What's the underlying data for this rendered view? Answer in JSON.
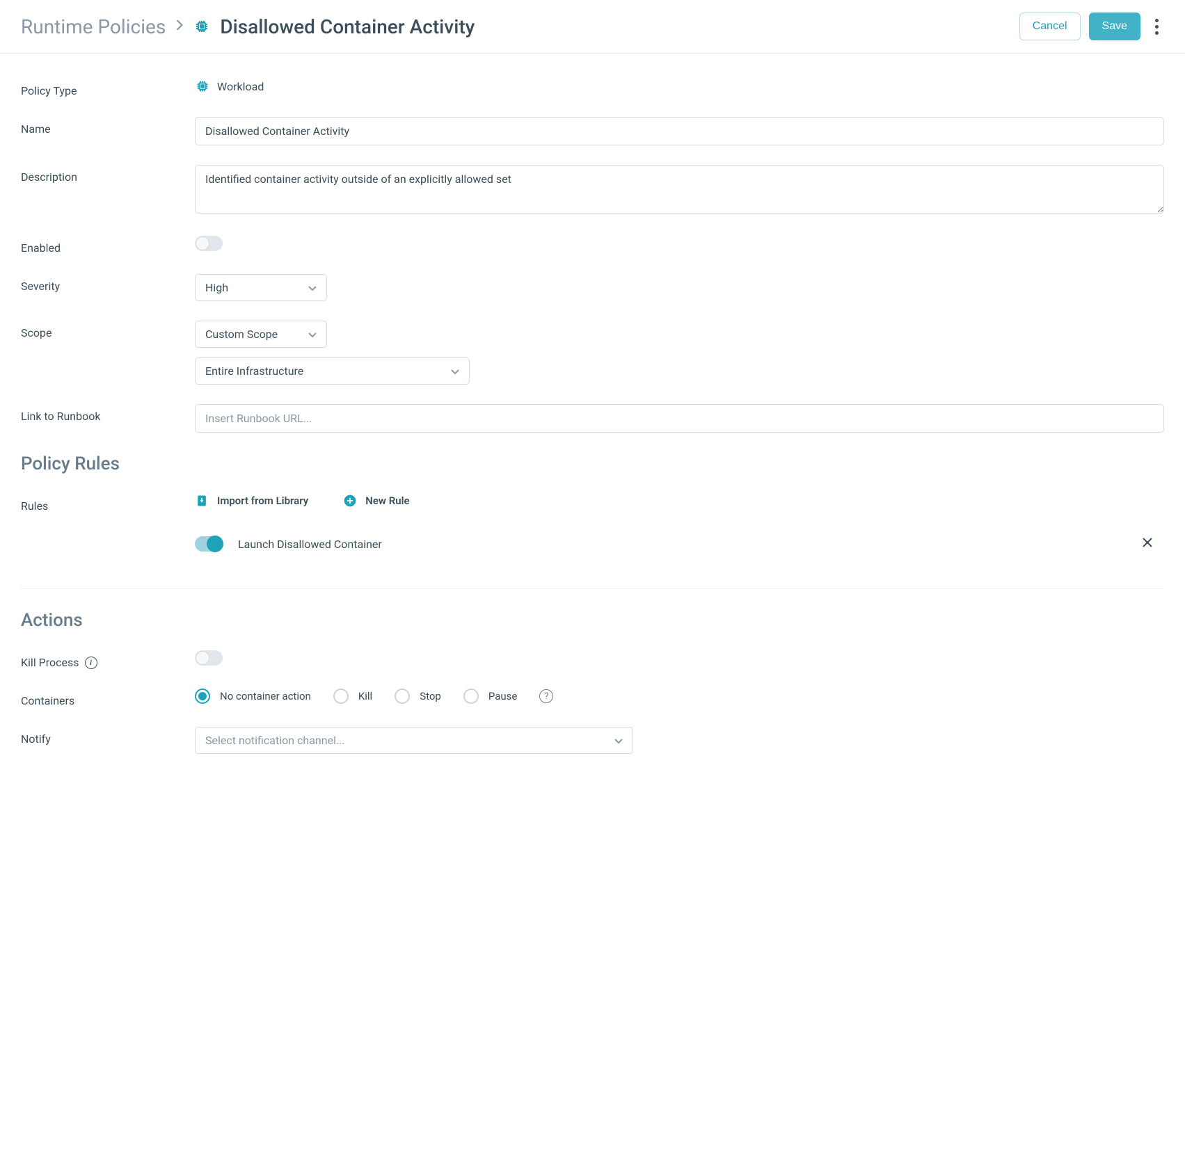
{
  "header": {
    "breadcrumb_root": "Runtime Policies",
    "title": "Disallowed Container Activity",
    "cancel_label": "Cancel",
    "save_label": "Save"
  },
  "form": {
    "policy_type_label": "Policy Type",
    "policy_type_value": "Workload",
    "name_label": "Name",
    "name_value": "Disallowed Container Activity",
    "description_label": "Description",
    "description_value": "Identified container activity outside of an explicitly allowed set",
    "enabled_label": "Enabled",
    "enabled_value": false,
    "severity_label": "Severity",
    "severity_value": "High",
    "scope_label": "Scope",
    "scope_value": "Custom Scope",
    "scope_target_value": "Entire Infrastructure",
    "runbook_label": "Link to Runbook",
    "runbook_placeholder": "Insert Runbook URL..."
  },
  "policy_rules": {
    "heading": "Policy Rules",
    "rules_label": "Rules",
    "import_label": "Import from Library",
    "new_rule_label": "New Rule",
    "items": [
      {
        "name": "Launch Disallowed Container",
        "enabled": true
      }
    ]
  },
  "actions": {
    "heading": "Actions",
    "kill_process_label": "Kill Process",
    "kill_process_value": false,
    "containers_label": "Containers",
    "container_options": [
      {
        "label": "No container action",
        "selected": true
      },
      {
        "label": "Kill",
        "selected": false
      },
      {
        "label": "Stop",
        "selected": false
      },
      {
        "label": "Pause",
        "selected": false
      }
    ],
    "notify_label": "Notify",
    "notify_placeholder": "Select notification channel..."
  },
  "colors": {
    "accent": "#1fa2b8",
    "text": "#3b4e5a",
    "muted": "#8a98a5",
    "border": "#d4dade"
  }
}
